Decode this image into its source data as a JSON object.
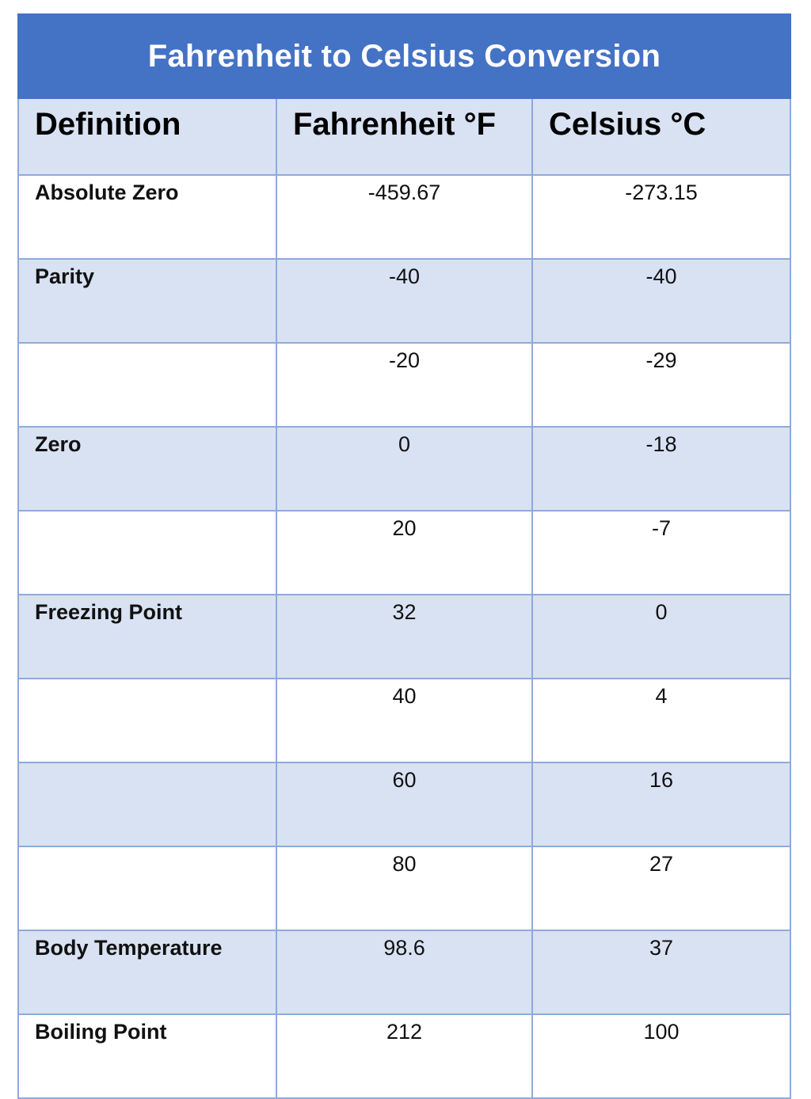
{
  "title": "Fahrenheit to Celsius Conversion",
  "columns": [
    "Definition",
    "Fahrenheit °F",
    "Celsius °C"
  ],
  "rows": [
    {
      "definition": "Absolute Zero",
      "fahrenheit": "-459.67",
      "celsius": "-273.15"
    },
    {
      "definition": "Parity",
      "fahrenheit": "-40",
      "celsius": "-40"
    },
    {
      "definition": "",
      "fahrenheit": "-20",
      "celsius": "-29"
    },
    {
      "definition": "Zero",
      "fahrenheit": "0",
      "celsius": "-18"
    },
    {
      "definition": "",
      "fahrenheit": "20",
      "celsius": "-7"
    },
    {
      "definition": "Freezing Point",
      "fahrenheit": "32",
      "celsius": "0"
    },
    {
      "definition": "",
      "fahrenheit": "40",
      "celsius": "4"
    },
    {
      "definition": "",
      "fahrenheit": "60",
      "celsius": "16"
    },
    {
      "definition": "",
      "fahrenheit": "80",
      "celsius": "27"
    },
    {
      "definition": "Body Temperature",
      "fahrenheit": "98.6",
      "celsius": "37"
    },
    {
      "definition": "Boiling Point",
      "fahrenheit": "212",
      "celsius": "100"
    }
  ],
  "colors": {
    "title_bg": "#4472c4",
    "band_bg": "#d9e2f3",
    "border": "#8eaadb"
  }
}
